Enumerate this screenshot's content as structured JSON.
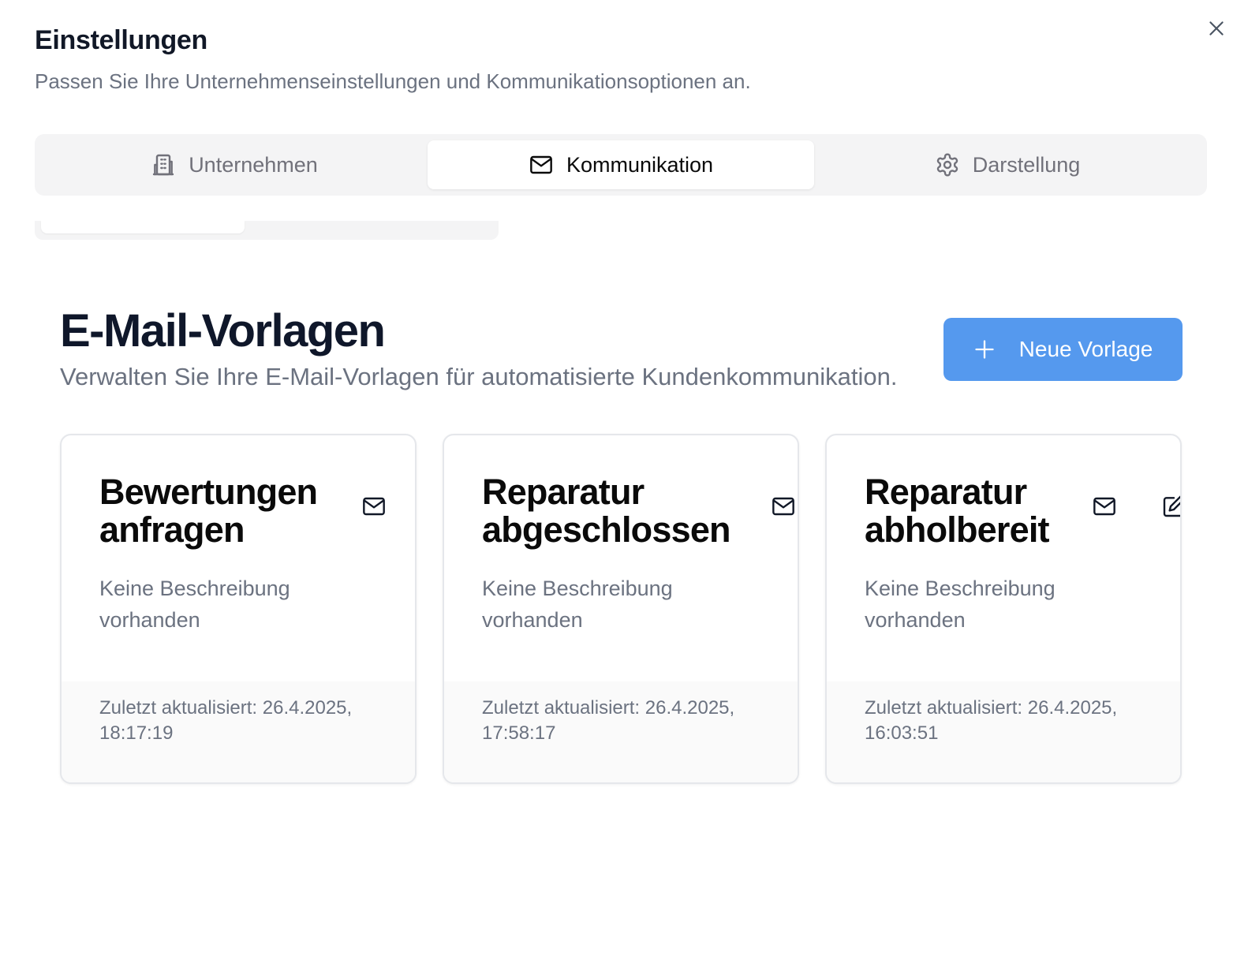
{
  "dialog": {
    "title": "Einstellungen",
    "subtitle": "Passen Sie Ihre Unternehmenseinstellungen und Kommunikationsoptionen an.",
    "close_icon": "close-icon"
  },
  "tabs": [
    {
      "label": "Unternehmen",
      "icon": "building-icon",
      "active": false
    },
    {
      "label": "Kommunikation",
      "icon": "mail-icon",
      "active": true
    },
    {
      "label": "Darstellung",
      "icon": "gear-icon",
      "active": false
    }
  ],
  "section": {
    "title": "E-Mail-Vorlagen",
    "description": "Verwalten Sie Ihre E-Mail-Vorlagen für automatisierte Kundenkommunikation.",
    "new_button_label": "Neue Vorlage",
    "new_button_icon": "plus-icon"
  },
  "templates": [
    {
      "title": "Bewertungen anfragen",
      "description": "Keine Beschreibung vorhanden",
      "updated": "Zuletzt aktualisiert: 26.4.2025, 18:17:19",
      "icons": [
        "mail-icon"
      ]
    },
    {
      "title": "Reparatur abgeschlossen",
      "description": "Keine Beschreibung vorhanden",
      "updated": "Zuletzt aktualisiert: 26.4.2025, 17:58:17",
      "icons": [
        "mail-icon"
      ]
    },
    {
      "title": "Reparatur abholbereit",
      "description": "Keine Beschreibung vorhanden",
      "updated": "Zuletzt aktualisiert: 26.4.2025, 16:03:51",
      "icons": [
        "mail-icon",
        "edit-icon"
      ]
    }
  ],
  "colors": {
    "accent": "#5599ee",
    "tab_bg": "#f4f4f5",
    "muted_text": "#6b7280"
  }
}
